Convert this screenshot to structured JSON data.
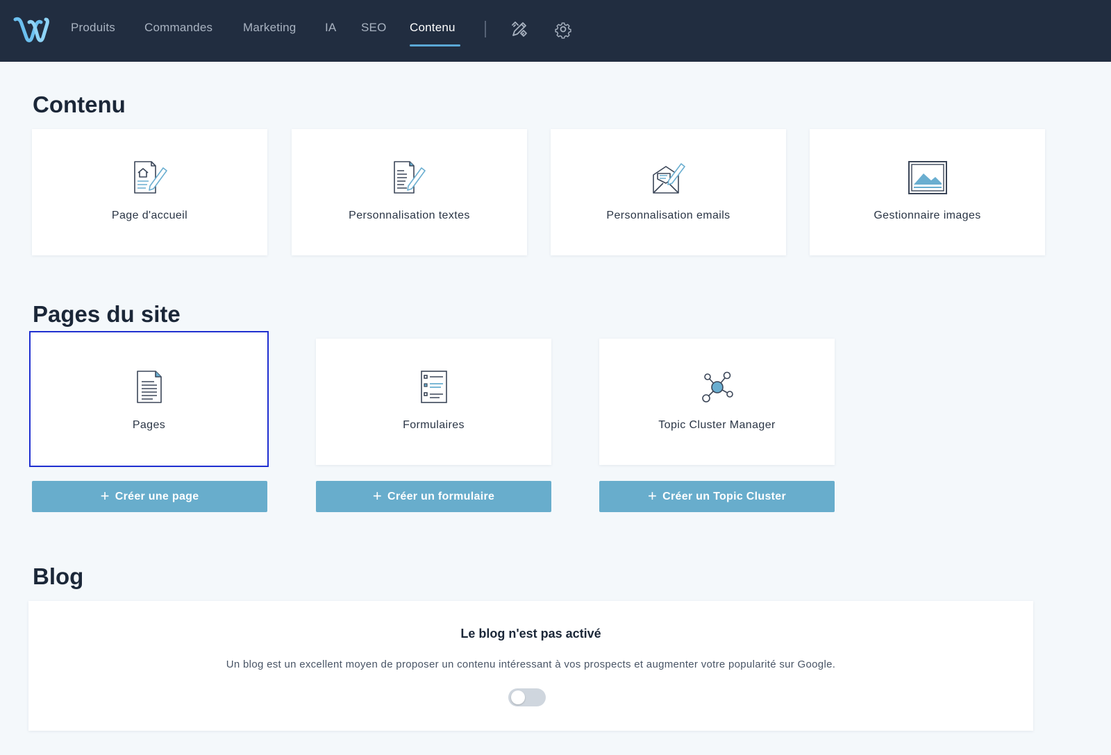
{
  "nav": {
    "items": [
      {
        "label": "Produits"
      },
      {
        "label": "Commandes"
      },
      {
        "label": "Marketing"
      },
      {
        "label": "IA"
      },
      {
        "label": "SEO"
      },
      {
        "label": "Contenu",
        "active": true
      }
    ],
    "icons": [
      "design-tools-icon",
      "gear-icon"
    ],
    "logo": "w-logo"
  },
  "contenu": {
    "title": "Contenu",
    "cards": [
      {
        "label": "Page d'accueil",
        "icon": "homepage-edit-icon"
      },
      {
        "label": "Personnalisation textes",
        "icon": "document-edit-icon"
      },
      {
        "label": "Personnalisation emails",
        "icon": "email-edit-icon"
      },
      {
        "label": "Gestionnaire images",
        "icon": "image-icon"
      }
    ]
  },
  "pages_du_site": {
    "title": "Pages du site",
    "cards": [
      {
        "label": "Pages",
        "icon": "page-icon",
        "selected": true
      },
      {
        "label": "Formulaires",
        "icon": "form-icon"
      },
      {
        "label": "Topic Cluster Manager",
        "icon": "topic-cluster-icon"
      }
    ],
    "buttons": [
      {
        "label": "Créer une page"
      },
      {
        "label": "Créer un formulaire"
      },
      {
        "label": "Créer un Topic Cluster"
      }
    ],
    "plus": "+"
  },
  "blog": {
    "title": "Blog",
    "status_title": "Le blog n'est pas activé",
    "description": "Un blog est un excellent moyen de proposer un contenu intéressant à vos prospects et augmenter votre popularité sur Google.",
    "toggle_on": false
  },
  "colors": {
    "topbar": "#212d40",
    "accent": "#5aa8d6",
    "button": "#68adcc",
    "background": "#f4f8fb",
    "selected_outline": "#1f2fd0"
  }
}
